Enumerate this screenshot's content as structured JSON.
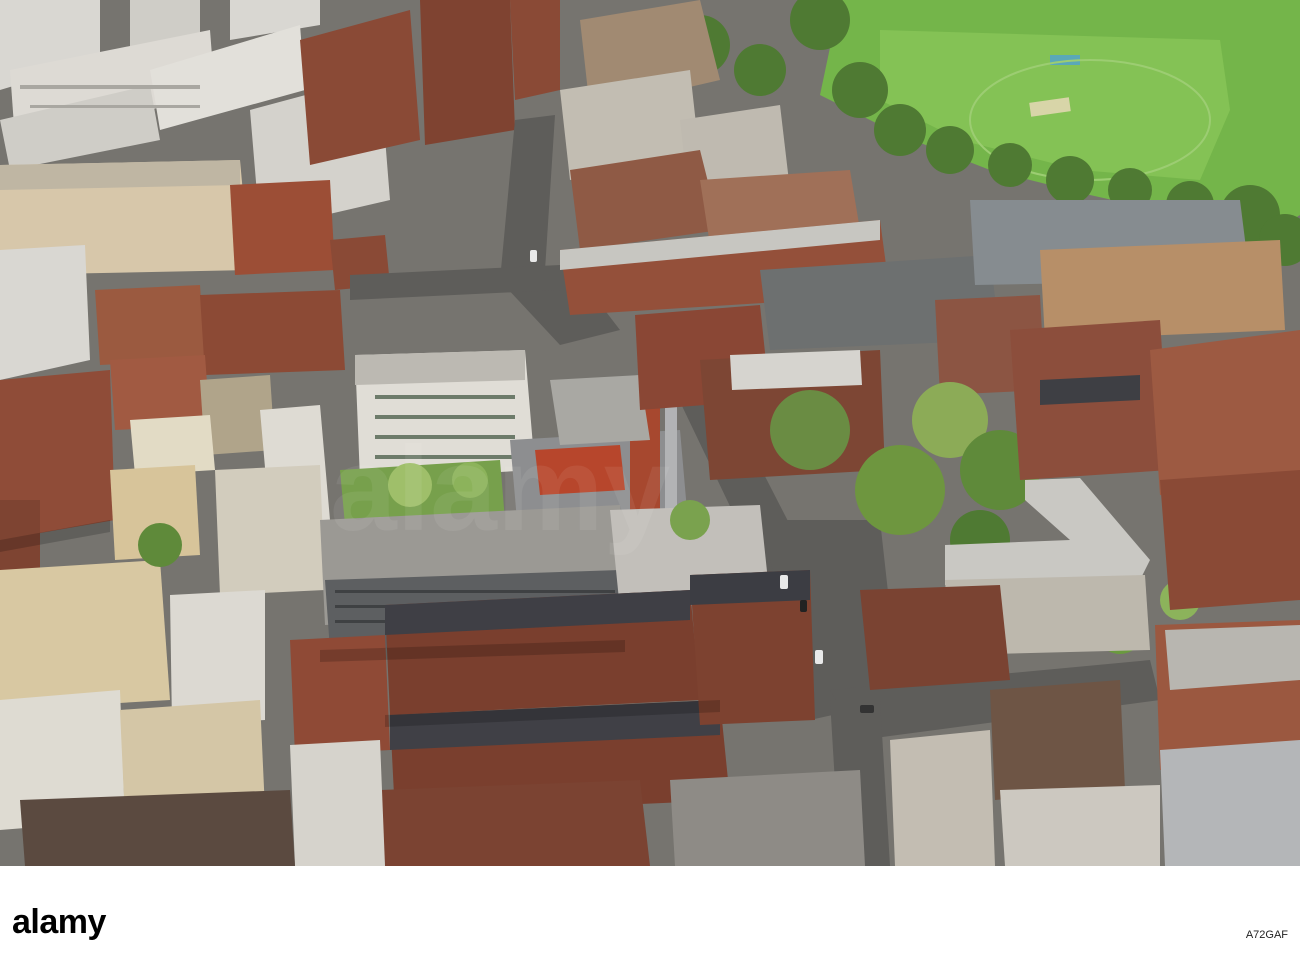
{
  "photo": {
    "subject": "aerial-city-view",
    "colors": {
      "pavement": "#7b7a76",
      "road": "#5c5c5a",
      "brick": "#8a4a36",
      "brick_dark": "#6b3627",
      "stone": "#c9b89a",
      "roof_grey": "#9a9a96",
      "roof_dark": "#3e3f44",
      "grass": "#74b54a",
      "tree": "#5f8a3a",
      "tree_light": "#9cbf6b",
      "white_block": "#d9d7d2"
    }
  },
  "footer": {
    "logo_text": "alamy",
    "image_id": "A72GAF"
  }
}
